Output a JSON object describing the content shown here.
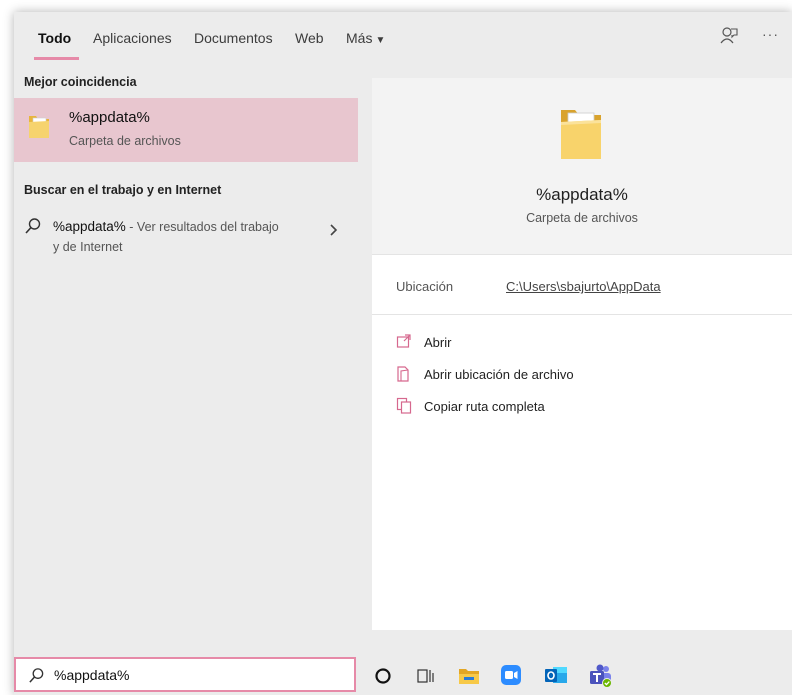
{
  "tabs": [
    {
      "label": "Todo",
      "active": true
    },
    {
      "label": "Aplicaciones"
    },
    {
      "label": "Documentos"
    },
    {
      "label": "Web"
    },
    {
      "label": "Más"
    }
  ],
  "toolbar_icons": [
    "feedback-icon",
    "more-options-icon"
  ],
  "left": {
    "best_match_header": "Mejor coincidencia",
    "best_match": {
      "title": "%appdata%",
      "subtitle": "Carpeta de archivos",
      "icon": "folder-icon"
    },
    "web_header": "Buscar en el trabajo y en Internet",
    "web_query": {
      "query": "%appdata%",
      "suffix": " - Ver resultados del trabajo",
      "suffix2": "y de Internet"
    }
  },
  "preview": {
    "title": "%appdata%",
    "subtitle": "Carpeta de archivos",
    "location_label": "Ubicación",
    "location_path": "C:\\Users\\sbajurto\\AppData",
    "actions": [
      {
        "label": "Abrir",
        "icon": "open-icon"
      },
      {
        "label": "Abrir ubicación de archivo",
        "icon": "open-file-location-icon"
      },
      {
        "label": "Copiar ruta completa",
        "icon": "copy-path-icon"
      }
    ]
  },
  "search": {
    "value": "%appdata%"
  },
  "taskbar_apps": [
    "cortana-icon",
    "task-view-icon",
    "file-explorer-icon",
    "zoom-icon",
    "outlook-icon",
    "teams-icon"
  ],
  "colors": {
    "accent": "#e68aa8",
    "selection": "#e8c6cf",
    "pane_bg": "#ececec"
  }
}
